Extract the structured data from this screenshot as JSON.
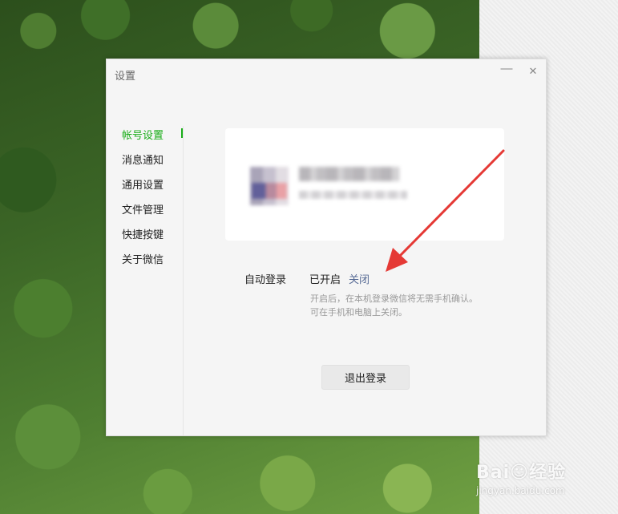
{
  "window": {
    "title": "设置",
    "min_glyph": "—",
    "close_glyph": "✕"
  },
  "sidebar": {
    "items": [
      {
        "label": "帐号设置",
        "active": true
      },
      {
        "label": "消息通知",
        "active": false
      },
      {
        "label": "通用设置",
        "active": false
      },
      {
        "label": "文件管理",
        "active": false
      },
      {
        "label": "快捷按键",
        "active": false
      },
      {
        "label": "关于微信",
        "active": false
      }
    ]
  },
  "account": {
    "auto_login_label": "自动登录",
    "auto_login_status": "已开启",
    "auto_login_toggle": "关闭",
    "auto_login_desc_line1": "开启后，在本机登录微信将无需手机确认。",
    "auto_login_desc_line2": "可在手机和电脑上关闭。",
    "logout_label": "退出登录"
  },
  "watermark": {
    "brand": "Bai☺经验",
    "url": "jingyan.baidu.com"
  },
  "colors": {
    "accent": "#1aad19",
    "link": "#576b95",
    "arrow": "#e53935"
  }
}
